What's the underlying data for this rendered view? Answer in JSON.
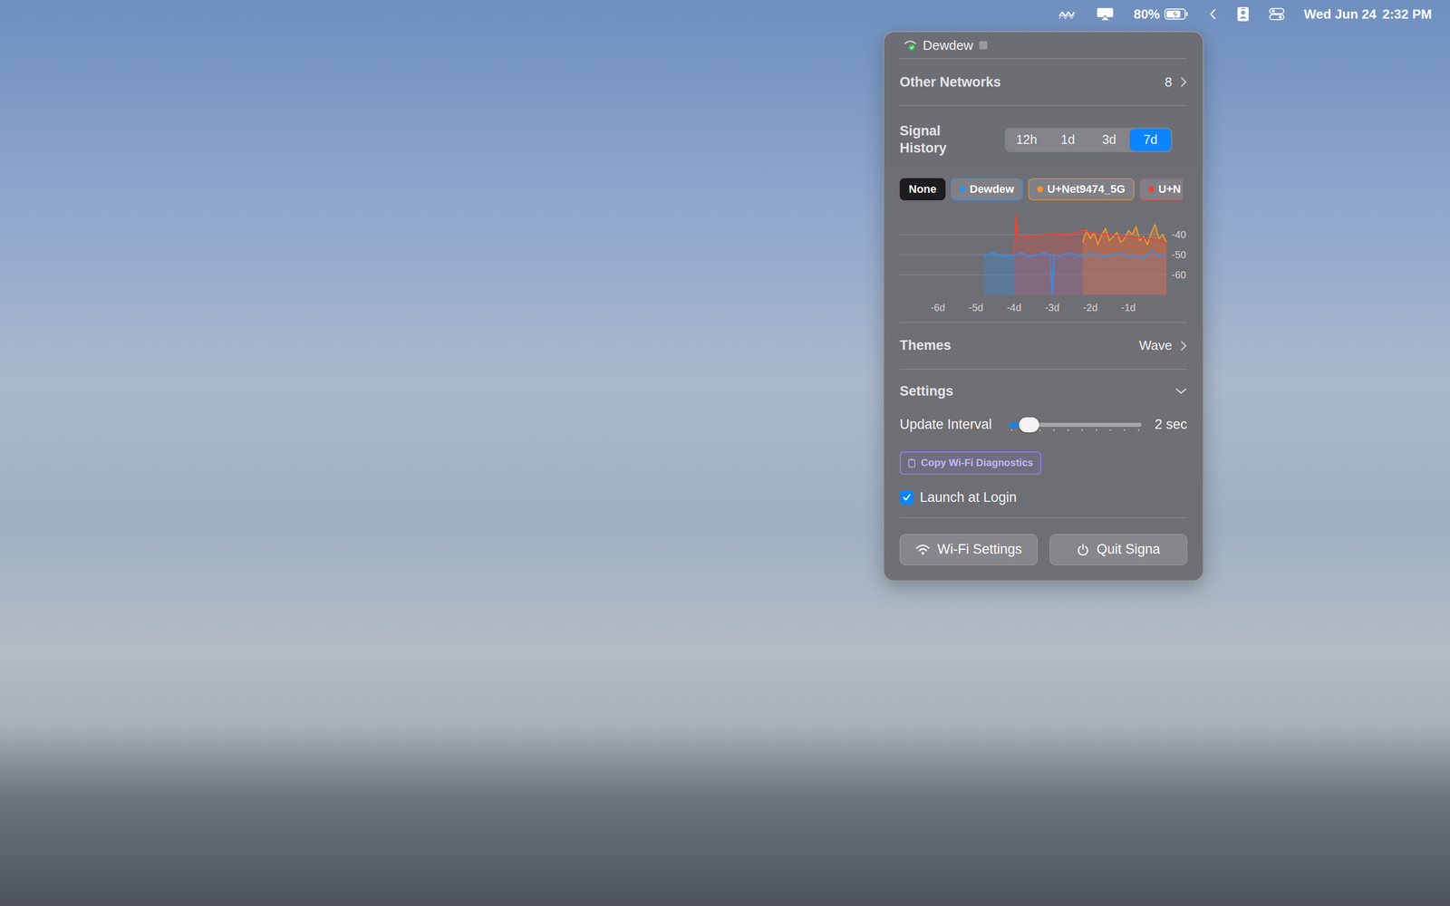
{
  "menu_bar": {
    "battery": {
      "reading": "80%",
      "level": 0.8,
      "charging": true
    },
    "date": "Wed Jun 24",
    "time": "2:32 PM"
  },
  "popup": {
    "current_network": {
      "name": "Dewdew",
      "connected": true
    },
    "other_networks": {
      "label": "Other Networks",
      "count": "8"
    },
    "signal_history": {
      "label": "Signal History",
      "ranges": [
        {
          "label": "12h",
          "selected": false
        },
        {
          "label": "1d",
          "selected": false
        },
        {
          "label": "3d",
          "selected": false
        },
        {
          "label": "7d",
          "selected": true
        }
      ],
      "none_chip": {
        "label": "None",
        "selected": true
      },
      "series": [
        {
          "label": "Dewdew",
          "color": "#2f8ff5",
          "selected": false,
          "cut": false,
          "times": [
            -4.8,
            -4.6,
            -4.4,
            -4.2,
            -4.0,
            -3.8,
            -3.6,
            -3.4,
            -3.2,
            -3.05,
            -3.0,
            -2.95,
            -2.8,
            -2.6,
            -2.4,
            -2.2,
            -2.0,
            -1.8,
            -1.6,
            -1.4,
            -1.2,
            -1.0,
            -0.8,
            -0.6,
            -0.4,
            -0.2,
            0
          ],
          "values": [
            -51,
            -49,
            -50,
            -51,
            -50,
            -49,
            -51,
            -50,
            -49,
            -50,
            -70,
            -50,
            -51,
            -49,
            -50,
            -51,
            -49,
            -50,
            -51,
            -50,
            -49,
            -51,
            -50,
            -52,
            -48,
            -51,
            -50
          ]
        },
        {
          "label": "U+Net9474_5G",
          "color": "#f5962a",
          "selected": false,
          "cut": false,
          "times": [
            -2.2,
            -2.1,
            -2.0,
            -1.9,
            -1.8,
            -1.7,
            -1.6,
            -1.5,
            -1.4,
            -1.3,
            -1.2,
            -1.1,
            -1.0,
            -0.9,
            -0.8,
            -0.7,
            -0.6,
            -0.5,
            -0.4,
            -0.3,
            -0.2,
            -0.1,
            0
          ],
          "values": [
            -44,
            -38,
            -42,
            -39,
            -45,
            -40,
            -37,
            -43,
            -41,
            -39,
            -44,
            -42,
            -38,
            -40,
            -36,
            -43,
            -41,
            -45,
            -39,
            -35,
            -42,
            -40,
            -44
          ]
        },
        {
          "label": "U+N",
          "color": "#e8453c",
          "selected": false,
          "cut": true,
          "times": [
            -4.0,
            -3.95,
            -3.9,
            -3.5,
            -3.0,
            -2.5,
            -2.2,
            -2.0,
            -1.5,
            -1.0,
            -0.5,
            -0.2,
            0
          ],
          "values": [
            -50,
            -30,
            -41,
            -40.5,
            -40,
            -39.5,
            -38,
            -39,
            -40,
            -41,
            -42,
            -43,
            -44
          ]
        }
      ],
      "y_ticks": [
        "-40",
        "-50",
        "-60"
      ],
      "x_ticks": [
        "-6d",
        "-5d",
        "-4d",
        "-3d",
        "-2d",
        "-1d"
      ]
    },
    "themes": {
      "label": "Themes",
      "value": "Wave"
    },
    "settings": {
      "label": "Settings",
      "expanded": true,
      "update_interval": {
        "label": "Update Interval",
        "level": 0.15,
        "reading": "2 sec",
        "steps": 10
      },
      "copy_button": "Copy Wi-Fi Diagnostics",
      "launch_at_login": {
        "label": "Launch at Login",
        "checked": true
      }
    },
    "buttons": [
      {
        "label": "Wi-Fi Settings",
        "kind": "wifi"
      },
      {
        "label": "Quit Signa",
        "kind": "power"
      }
    ]
  }
}
